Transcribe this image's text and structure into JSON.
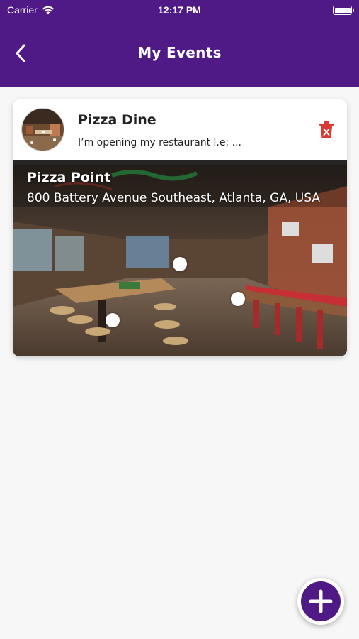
{
  "status_bar": {
    "carrier": "Carrier",
    "time": "12:17 PM",
    "wifi_icon": "wifi-icon",
    "battery_icon": "battery-icon"
  },
  "header": {
    "title": "My Events",
    "back_icon": "chevron-left-icon",
    "background_color": "#4f1a86"
  },
  "events": [
    {
      "title": "Pizza Dine",
      "description": "I’m opening my restaurant l.e; ...",
      "delete_icon": "trash-icon",
      "delete_color": "#d93b34",
      "place_name": "Pizza Point",
      "place_address": "800 Battery Avenue Southeast, Atlanta, GA, USA"
    }
  ],
  "fab": {
    "icon": "plus-icon",
    "color": "#4f1a86"
  }
}
